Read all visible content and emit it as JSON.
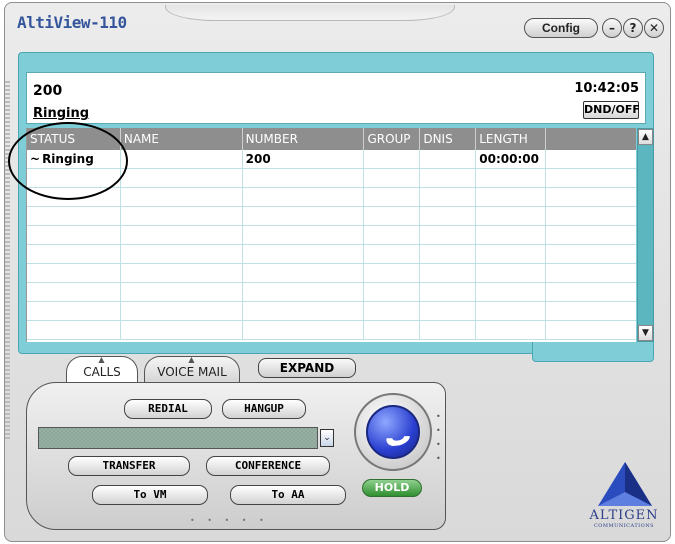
{
  "window": {
    "title": "AltiView-110",
    "config_label": "Config",
    "minimize_label": "–",
    "help_label": "?",
    "close_label": "✕"
  },
  "info_panel": {
    "number": "200",
    "status": "Ringing",
    "time": "10:42:05",
    "dnd_label": "DND/OFF"
  },
  "grid": {
    "columns": [
      "STATUS",
      "NAME",
      "NUMBER",
      "GROUP",
      "DNIS",
      "LENGTH",
      ""
    ],
    "rows": [
      [
        "Ringing",
        "",
        "200",
        "",
        "",
        "00:00:00",
        ""
      ]
    ],
    "status_icon": "ringing-wave-icon"
  },
  "tabs": {
    "calls_label": "CALLS",
    "voicemail_label": "VOICE MAIL",
    "expand_label": "EXPAND"
  },
  "controls": {
    "redial_label": "REDIAL",
    "hangup_label": "HANGUP",
    "transfer_label": "TRANSFER",
    "conference_label": "CONFERENCE",
    "to_vm_label": "To VM",
    "to_aa_label": "To AA",
    "hold_label": "HOLD",
    "dial_value": ""
  },
  "logo": {
    "name": "ALTIGEN",
    "tagline": "COMMUNICATIONS"
  },
  "colors": {
    "accent_teal": "#7fcdd6",
    "title_blue": "#34559c",
    "phone_blue": "#2a3fd0",
    "hold_green": "#2f8f2f"
  }
}
